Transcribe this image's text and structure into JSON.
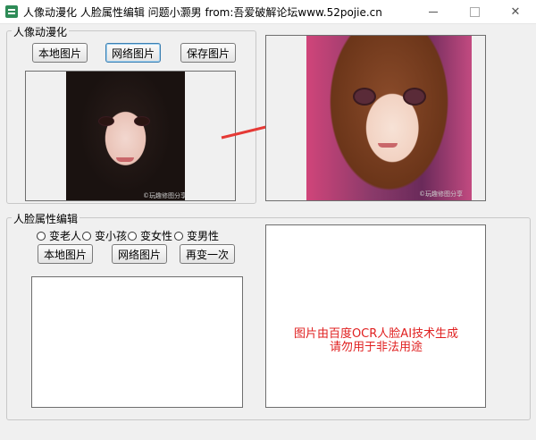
{
  "window": {
    "title": "人像动漫化 人脸属性编辑 问题小灏男 from:吾爱破解论坛www.52pojie.cn",
    "icon": "app-icon"
  },
  "anime_group": {
    "legend": "人像动漫化",
    "buttons": {
      "local": "本地图片",
      "network": "网络图片",
      "save": "保存图片"
    },
    "source_watermark": "©玩趣修图分享",
    "result_watermark": "©玩趣修图分享",
    "arrow_color": "#e53935"
  },
  "face_group": {
    "legend": "人脸属性编辑",
    "radios": [
      "变老人",
      "变小孩",
      "变女性",
      "变男性"
    ],
    "buttons": {
      "local": "本地图片",
      "network": "网络图片",
      "retry": "再变一次"
    },
    "notice_line1": "图片由百度OCR人脸AI技术生成",
    "notice_line2": "请勿用于非法用途",
    "notice_color": "#e02020"
  }
}
